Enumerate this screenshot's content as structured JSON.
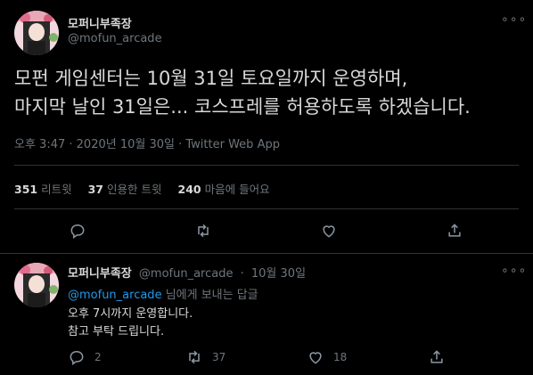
{
  "main_tweet": {
    "display_name": "모퍼니부족장",
    "handle": "@mofun_arcade",
    "text_line1": "모펀 게임센터는 10월 31일 토요일까지 운영하며,",
    "text_line2": "마지막 날인 31일은... 코스프레를 허용하도록 하겠습니다.",
    "time": "오후 3:47",
    "sep1": " · ",
    "date": "2020년 10월 30일",
    "sep2": " · ",
    "source": "Twitter Web App",
    "stats": {
      "retweets_count": "351",
      "retweets_label": "리트윗",
      "quotes_count": "37",
      "quotes_label": "인용한 트윗",
      "likes_count": "240",
      "likes_label": "마음에 들어요"
    }
  },
  "reply": {
    "display_name": "모퍼니부족장",
    "handle": "@mofun_arcade",
    "sep": "·",
    "date": "10월 30일",
    "replying_mention": "@mofun_arcade",
    "replying_suffix": " 님에게 보내는 답글",
    "text_line1": "오후 7시까지 운영합니다.",
    "text_line2": "참고 부탁 드립니다.",
    "reply_count": "2",
    "retweet_count": "37",
    "like_count": "18"
  },
  "more_label": "∘∘∘",
  "colors": {
    "background": "#000000",
    "text": "#d9d9d9",
    "secondary": "#6e767d",
    "link": "#1d9bf0",
    "divider": "#2f3336"
  },
  "icons": [
    "reply-icon",
    "retweet-icon",
    "like-icon",
    "share-icon",
    "more-icon"
  ]
}
